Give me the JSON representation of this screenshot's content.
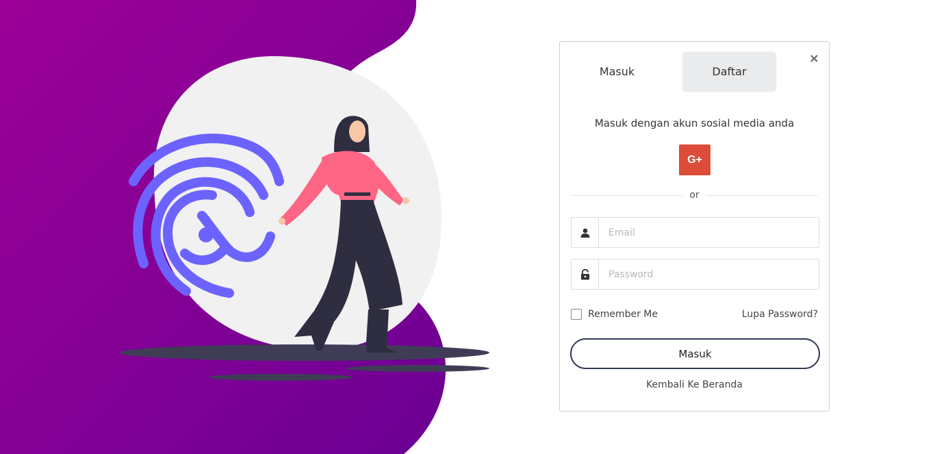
{
  "tabs": {
    "login_label": "Masuk",
    "register_label": "Daftar",
    "close_glyph": "×"
  },
  "social": {
    "title": "Masuk dengan akun sosial media anda",
    "gplus_label": "G+"
  },
  "divider": {
    "label": "or"
  },
  "form": {
    "email": {
      "placeholder": "Email",
      "value": ""
    },
    "password": {
      "placeholder": "Password",
      "value": ""
    },
    "remember_label": "Remember Me",
    "remember_checked": false,
    "forgot_label": "Lupa Password?",
    "submit_label": "Masuk"
  },
  "back_link": "Kembali Ke Beranda",
  "icons": {
    "email": "user-icon",
    "password": "unlock-icon",
    "close": "close-icon"
  },
  "colors": {
    "hero_gradient_start": "#9c0096",
    "hero_gradient_end": "#6c0094",
    "fingerprint": "#6c63ff",
    "google_red": "#dd4b39",
    "button_border": "#2f3a52"
  }
}
